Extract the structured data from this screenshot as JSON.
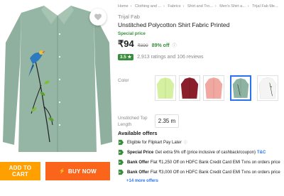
{
  "breadcrumb": [
    "Home",
    "Clothing and ...",
    "Fabrics",
    "Shirt and Tro...",
    "Men's Shirt a...",
    "Trijal Fab Me..."
  ],
  "product": {
    "brand": "Trijal Fab",
    "title": "Unstitched Polycotton Shirt Fabric Printed",
    "special_price_label": "Special price",
    "price": "₹94",
    "mrp": "₹899",
    "discount": "89% off",
    "rating": "3.5 ★",
    "rating_text": "2,913 ratings and 106 reviews"
  },
  "color": {
    "label": "Color",
    "swatches": [
      {
        "name": "lime",
        "hex": "#d4f0a0"
      },
      {
        "name": "maroon",
        "hex": "#8b1e2b"
      },
      {
        "name": "salmon",
        "hex": "#f0a8a0"
      },
      {
        "name": "sage",
        "hex": "#8fb3a2",
        "selected": true
      },
      {
        "name": "white-printed",
        "hex": "#f4f4f4"
      }
    ]
  },
  "size": {
    "label": "Unstitched Top Length",
    "value": "2.35 m"
  },
  "offers": {
    "title": "Available offers",
    "items": [
      {
        "bold": "",
        "text": "Eligible for Flipkart Pay Later",
        "link": ""
      },
      {
        "bold": "Special Price",
        "text": "Get extra 5% off (price inclusive of cashback/coupon)",
        "link": "T&C"
      },
      {
        "bold": "Bank Offer",
        "text": "Flat ₹1,250 Off on HDFC Bank Credit Card EMI Txns on orders price",
        "link": ""
      },
      {
        "bold": "Bank Offer",
        "text": "Flat ₹3,000 Off on HDFC Bank Credit Card EMI Txns on orders price",
        "link": ""
      }
    ],
    "more": "+14 more offers"
  },
  "actions": {
    "add_to_cart": "ADD TO CART",
    "buy_now": "BUY NOW"
  },
  "colors": {
    "shirt": "#93b3a1",
    "cart": "#ff9f00",
    "buy": "#fb641b",
    "green": "#388e3c",
    "link": "#2874f0"
  }
}
